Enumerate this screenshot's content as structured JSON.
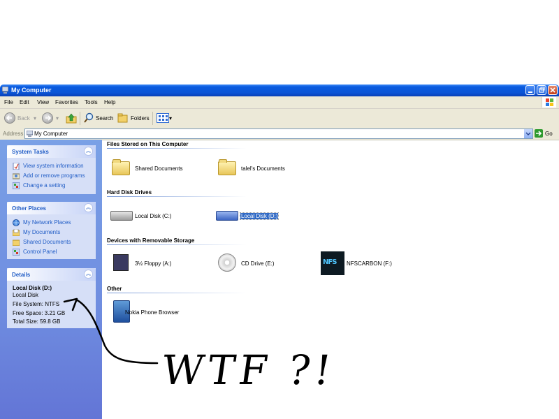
{
  "window": {
    "title": "My Computer"
  },
  "menu": [
    "File",
    "Edit",
    "View",
    "Favorites",
    "Tools",
    "Help"
  ],
  "toolbar": {
    "back_label": "Back",
    "search_label": "Search",
    "folders_label": "Folders"
  },
  "address": {
    "label": "Address",
    "value": "My Computer",
    "go_label": "Go"
  },
  "left_pane": {
    "system_tasks": {
      "title": "System Tasks",
      "items": [
        "View system information",
        "Add or remove programs",
        "Change a setting"
      ]
    },
    "other_places": {
      "title": "Other Places",
      "items": [
        "My Network Places",
        "My Documents",
        "Shared Documents",
        "Control Panel"
      ]
    },
    "details": {
      "title": "Details",
      "name": "Local Disk (D:)",
      "type": "Local Disk",
      "file_system": "File System: NTFS",
      "free_space": "Free Space: 3.21 GB",
      "total_size": "Total Size: 59.8 GB"
    }
  },
  "content": {
    "groups": [
      {
        "title": "Files Stored on This Computer",
        "items": [
          "Shared Documents",
          "talel's Documents"
        ]
      },
      {
        "title": "Hard Disk Drives",
        "items": [
          "Local Disk (C:)",
          "Local Disk (D:)"
        ]
      },
      {
        "title": "Devices with Removable Storage",
        "items": [
          "3½ Floppy (A:)",
          "CD Drive (E:)",
          "NFSCARBON (F:)"
        ]
      },
      {
        "title": "Other",
        "items": [
          "Nokia Phone Browser"
        ]
      }
    ],
    "selected_item": "Local Disk (D:)",
    "nfs_icon_text": "NFS"
  },
  "annotation": {
    "text": "WTF ?!"
  },
  "colors": {
    "titlebar": "#0a5bdf",
    "left_pane": "#6f8de0",
    "link": "#215dc6",
    "selection": "#316ac5"
  }
}
